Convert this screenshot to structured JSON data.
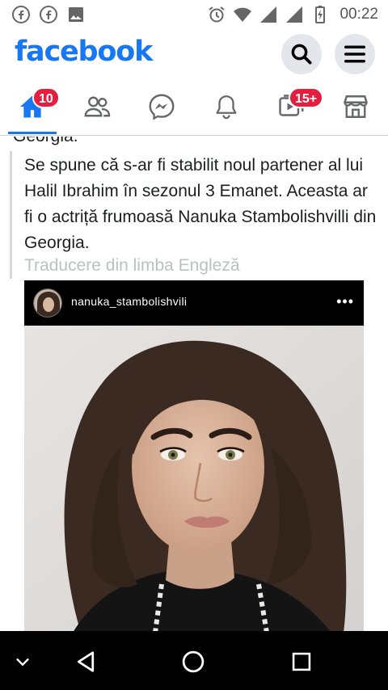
{
  "status_bar": {
    "time": "00:22",
    "left_icons": [
      "facebook-icon",
      "facebook-icon",
      "image-icon"
    ],
    "right_icons": [
      "alarm-icon",
      "wifi-icon",
      "signal-icon",
      "signal-icon",
      "battery-icon"
    ]
  },
  "header": {
    "logo": "facebook",
    "brand_color": "#1877f2",
    "search_icon": "search-icon",
    "menu_icon": "menu-icon"
  },
  "nav": {
    "items": [
      {
        "name": "home",
        "icon": "home-icon",
        "badge": "10",
        "active": true
      },
      {
        "name": "friends",
        "icon": "friends-icon",
        "badge": "",
        "active": false
      },
      {
        "name": "messenger",
        "icon": "messenger-icon",
        "badge": "",
        "active": false
      },
      {
        "name": "notifications",
        "icon": "bell-icon",
        "badge": "",
        "active": false
      },
      {
        "name": "watch",
        "icon": "video-icon",
        "badge": "15+",
        "active": false
      },
      {
        "name": "marketplace",
        "icon": "store-icon",
        "badge": "",
        "active": false
      }
    ],
    "badge_color": "#e41e3f"
  },
  "post": {
    "cut_text": "Georgia.",
    "text": "Se spune că s-ar fi stabilit noul partener al lui Halil Ibrahim în sezonul 3 Emanet. Aceasta ar fi o actriță frumoasă Nanuka Stambolishvilli din Georgia.",
    "translation_link": "Traducere din limba Engleză",
    "embed": {
      "username": "nanuka_stambolishvili",
      "more_icon": "more-icon"
    }
  },
  "system_nav": {
    "icons": [
      "chevron-down-icon",
      "back-icon",
      "home-circle-icon",
      "recents-icon"
    ]
  }
}
